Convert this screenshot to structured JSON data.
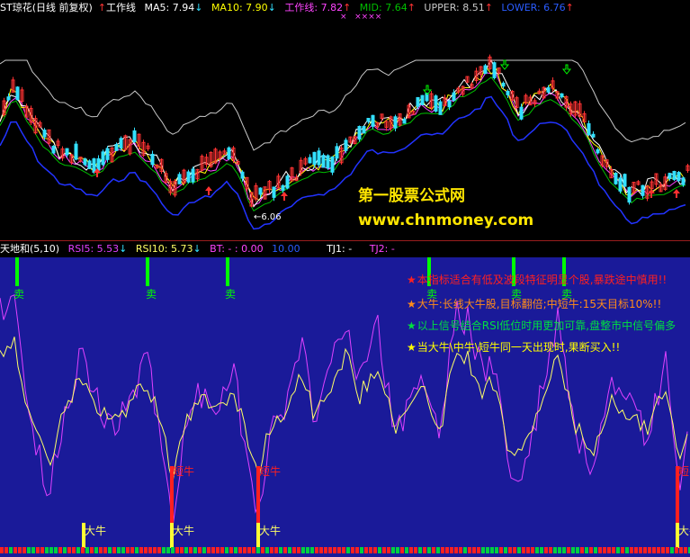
{
  "top_bar": {
    "stock_name": "ST琼花(日线 前复权)",
    "arrow_up": "↑",
    "arrow_down": "↓",
    "work_line_label": "工作线",
    "ma5": "MA5: 7.94",
    "ma10": "MA10: 7.90",
    "work_line_value": "工作线: 7.82",
    "mid": "MID: 7.64",
    "upper": "UPPER: 8.51",
    "lower": "LOWER: 6.76",
    "marks": "×   ××××",
    "low_price_marker": "6.06"
  },
  "indicator_bar": {
    "name": "天地和(5,10)",
    "rsi5": "RSI5: 5.53",
    "rsi10": "RSI10: 5.73",
    "bt": "BT: - : 0.00",
    "bt_extra": "10.00",
    "tj1": "TJ1: -",
    "tj2": "TJ2: -"
  },
  "watermark": {
    "line1": "第一股票公式网",
    "line2": "www.chnmoney.com"
  },
  "notes": [
    "本指标适合有低及波段特征明显个股,暴跌途中慎用!!",
    "大牛:长线大牛股,目标翻倍;中短牛:15天目标10%!!",
    "以上信号结合RSI低位时用更加可靠,盘整市中信号偏多",
    "当大牛\\中牛\\短牛同一天出现时,果断买入!!"
  ],
  "note_star": "★",
  "signals": {
    "sell": "卖",
    "short_bull": "短牛",
    "big_bull": "大牛"
  },
  "colors": {
    "up_candle": "#ff3333",
    "down_candle": "#33e0ff",
    "ma5": "#ffffff",
    "ma10": "#ffff00",
    "work_line": "#ff44ff",
    "mid": "#00c000",
    "upper": "#c8c8c8",
    "lower": "#2233ff",
    "panel_bg": "#1a1a99",
    "rsi5": "#e040ff",
    "rsi10": "#ffff66",
    "sell_signal": "#00ff00",
    "bull_signal": "#ff2020"
  }
}
